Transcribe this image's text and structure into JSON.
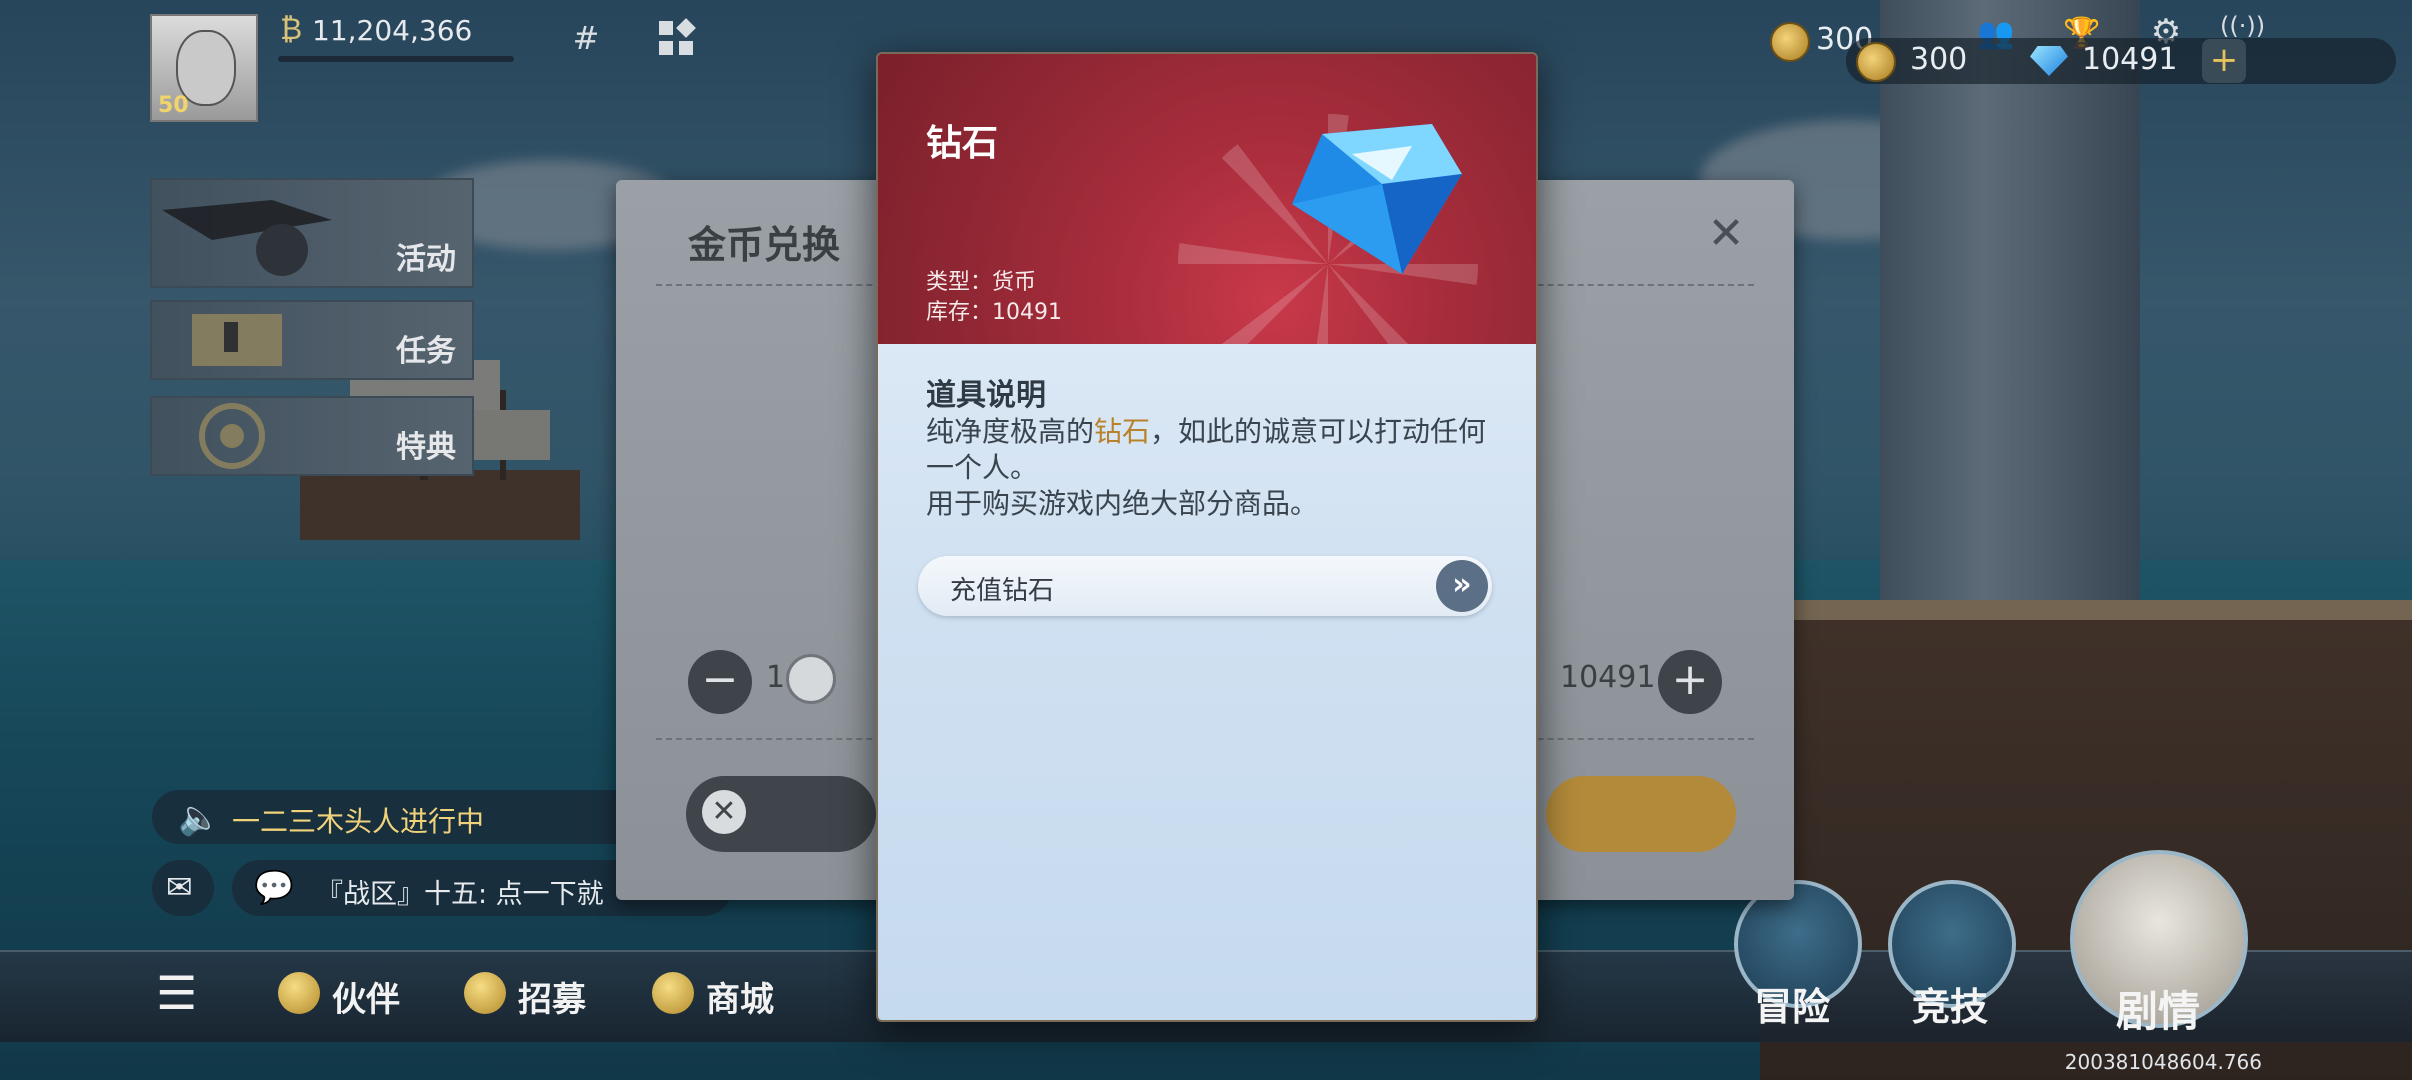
{
  "hud": {
    "level": "50",
    "berry_amount": "11,204,366",
    "gold_top": "300",
    "gold": "300",
    "diamonds": "10491",
    "plus": "+"
  },
  "side_menu": [
    {
      "label": "活动"
    },
    {
      "label": "任务"
    },
    {
      "label": "特典"
    }
  ],
  "notice_text": "一二三木头人进行中",
  "chat_text": "『战区』十五: 点一下就",
  "bottom_nav": [
    {
      "label": "伙伴"
    },
    {
      "label": "招募"
    },
    {
      "label": "商城"
    }
  ],
  "big_nav": [
    {
      "label": "冒险"
    },
    {
      "label": "竞技"
    },
    {
      "label": "剧情"
    }
  ],
  "version": "200381048604.766",
  "exchange_dialog": {
    "title": "金币兑换",
    "qty_min": "1",
    "qty_max": "10491",
    "minus": "−",
    "plus": "+"
  },
  "item_popup": {
    "name": "钻石",
    "type_line": "类型：货币",
    "stock_line": "库存：10491",
    "desc_title": "道具说明",
    "desc_part1": "纯净度极高的",
    "desc_highlight": "钻石",
    "desc_part2": "，如此的诚意可以打动任何一个人。",
    "desc_line3": "用于购买游戏内绝大部分商品。",
    "recharge_label": "充值钻石",
    "recharge_arrow": "»"
  },
  "colors": {
    "popup_header": "#a82d3c",
    "popup_body": "#cfe0f1",
    "highlight": "#b8822a"
  }
}
